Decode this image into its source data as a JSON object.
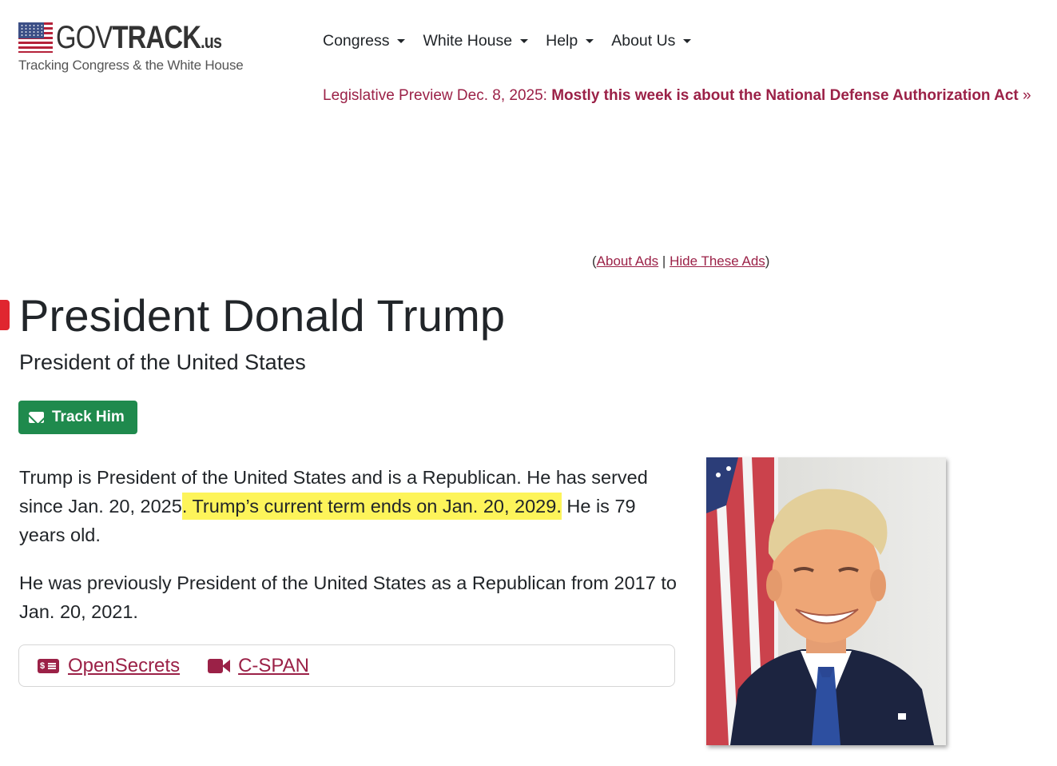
{
  "header": {
    "logo": {
      "gov": "GOV",
      "track": "TRACK",
      "us": ".us",
      "tagline": "Tracking Congress & the White House"
    },
    "nav": [
      {
        "label": "Congress"
      },
      {
        "label": "White House"
      },
      {
        "label": "Help"
      },
      {
        "label": "About Us"
      }
    ],
    "preview": {
      "prefix": "Legislative Preview Dec. 8, 2025: ",
      "headline": "Mostly this week is about the National Defense Authorization Act",
      "arrow": " »"
    }
  },
  "ads": {
    "open_paren": "(",
    "about_ads": "About Ads",
    "separator": " | ",
    "hide_ads": "Hide These Ads",
    "close_paren": ")"
  },
  "profile": {
    "title": "President Donald Trump",
    "subtitle": "President of the United States",
    "track_button": "Track Him",
    "bio": {
      "p1_start": "Trump is President of the United States and is a Republican. He has served since Jan. 20, 2025",
      "p1_highlight": ". Trump’s current term ends on Jan. 20, 2029.",
      "p1_end": " He is 79 years old.",
      "p2": "He was previously President of the United States as a Republican from 2017 to Jan. 20, 2021."
    },
    "links": [
      {
        "icon": "money-icon",
        "label": "OpenSecrets"
      },
      {
        "icon": "video-camera-icon",
        "label": "C-SPAN"
      }
    ],
    "money_icon_text": "$"
  },
  "colors": {
    "brand": "#9b2147",
    "button_green": "#1f8a4d",
    "highlight": "#fdf45a",
    "flag_red": "#b5223a",
    "flag_blue": "#3c4f86"
  }
}
